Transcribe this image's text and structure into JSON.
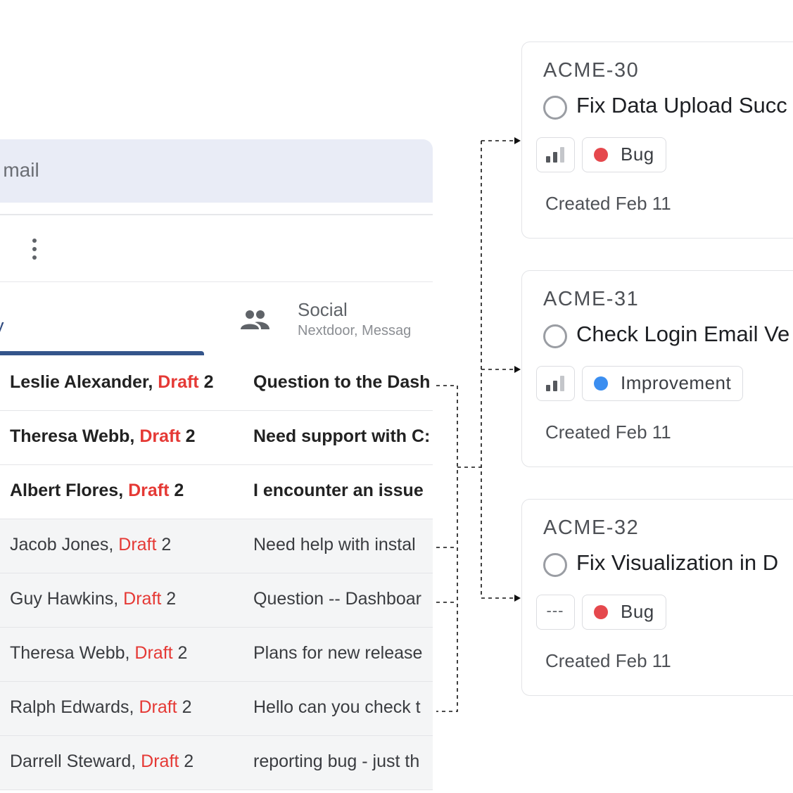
{
  "mail": {
    "search_placeholder": "ch mail",
    "tabs": {
      "primary_label": "y",
      "social_title": "Social",
      "social_subtitle": "Nextdoor, Messag"
    },
    "rows": [
      {
        "sender": "Leslie Alexander, ",
        "draft": "Draft",
        "count": " 2",
        "subject": "Question to the Dash",
        "unread": true
      },
      {
        "sender": "Theresa Webb, ",
        "draft": "Draft",
        "count": " 2",
        "subject": "Need support with C:",
        "unread": true
      },
      {
        "sender": "Albert Flores, ",
        "draft": "Draft",
        "count": " 2",
        "subject": "I encounter an issue",
        "unread": true
      },
      {
        "sender": "Jacob Jones, ",
        "draft": "Draft",
        "count": " 2",
        "subject": "Need help with instal",
        "unread": false
      },
      {
        "sender": "Guy Hawkins, ",
        "draft": "Draft",
        "count": " 2",
        "subject": "Question -- Dashboar",
        "unread": false
      },
      {
        "sender": "Theresa Webb, ",
        "draft": "Draft",
        "count": " 2",
        "subject": "Plans for new release",
        "unread": false
      },
      {
        "sender": "Ralph Edwards, ",
        "draft": "Draft",
        "count": " 2",
        "subject": "Hello can you check t",
        "unread": false
      },
      {
        "sender": "Darrell Steward, ",
        "draft": "Draft",
        "count": " 2",
        "subject": "reporting bug - just th",
        "unread": false
      }
    ]
  },
  "issues": [
    {
      "id": "ACME-30",
      "title": "Fix Data Upload Succ",
      "priority": "medium",
      "label": "Bug",
      "label_color": "#e5484d",
      "created": "Created Feb 11"
    },
    {
      "id": "ACME-31",
      "title": "Check Login Email Ve",
      "priority": "medium",
      "label": "Improvement",
      "label_color": "#3b8ef0",
      "created": "Created Feb 11"
    },
    {
      "id": "ACME-32",
      "title": "Fix Visualization in D",
      "priority": "none",
      "priority_text": "---",
      "label": "Bug",
      "label_color": "#e5484d",
      "created": "Created Feb 11"
    }
  ],
  "icons": {
    "toolbar": "more-vertical-icon",
    "social_tab": "people-icon",
    "status": "circle-status-icon",
    "priority": "signal-bars-icon"
  },
  "colors": {
    "draft": "#e53935",
    "tab_accent": "#34558b",
    "search_bg": "#e9ecf6"
  }
}
